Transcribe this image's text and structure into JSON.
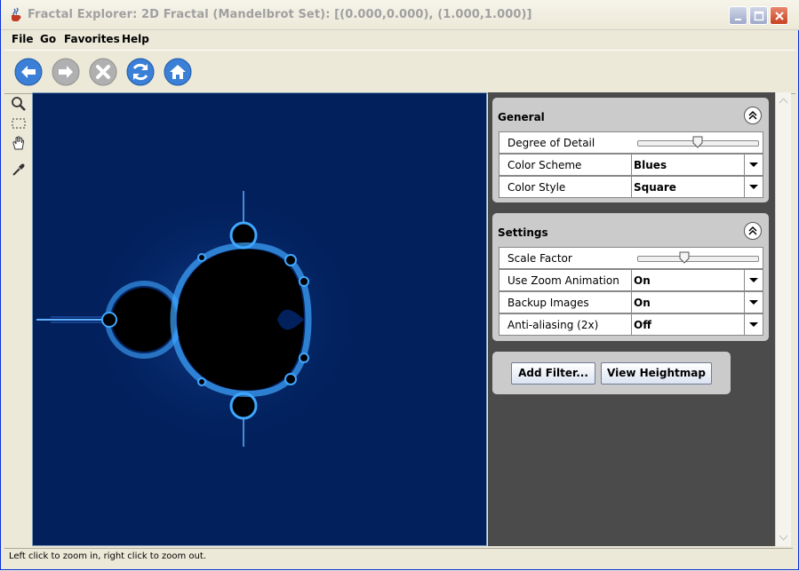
{
  "window": {
    "title": "Fractal Explorer: 2D Fractal (Mandelbrot Set): [(0.000,0.000), (1.000,1.000)]"
  },
  "menu": {
    "file": "File",
    "go": "Go",
    "favorites": "Favorites",
    "help": "Help"
  },
  "toolbar": {
    "back_icon": "back-arrow-icon",
    "forward_icon": "forward-arrow-icon",
    "stop_icon": "stop-x-icon",
    "refresh_icon": "refresh-icon",
    "home_icon": "home-icon"
  },
  "tools": [
    "zoom-icon",
    "select-rect-icon",
    "pan-hand-icon",
    "eyedropper-icon"
  ],
  "general": {
    "title": "General",
    "detail_label": "Degree of Detail",
    "detail_value": 0.5,
    "scheme_label": "Color Scheme",
    "scheme_value": "Blues",
    "style_label": "Color Style",
    "style_value": "Square"
  },
  "settings": {
    "title": "Settings",
    "scale_label": "Scale Factor",
    "scale_value": 0.4,
    "zoom_anim_label": "Use Zoom Animation",
    "zoom_anim_value": "On",
    "backup_label": "Backup Images",
    "backup_value": "On",
    "aa_label": "Anti-aliasing (2x)",
    "aa_value": "Off"
  },
  "buttons": {
    "add_filter": "Add Filter...",
    "view_heightmap": "View Heightmap"
  },
  "status": "Left click to zoom in, right click to zoom out.",
  "colors": {
    "fractal_bg": "#01205c",
    "fractal_glow": "#3fa7ff",
    "panel_bg": "#cbcbcb",
    "side_bg": "#4b4b4b",
    "toolbar_icon": "#3b7fd6"
  }
}
